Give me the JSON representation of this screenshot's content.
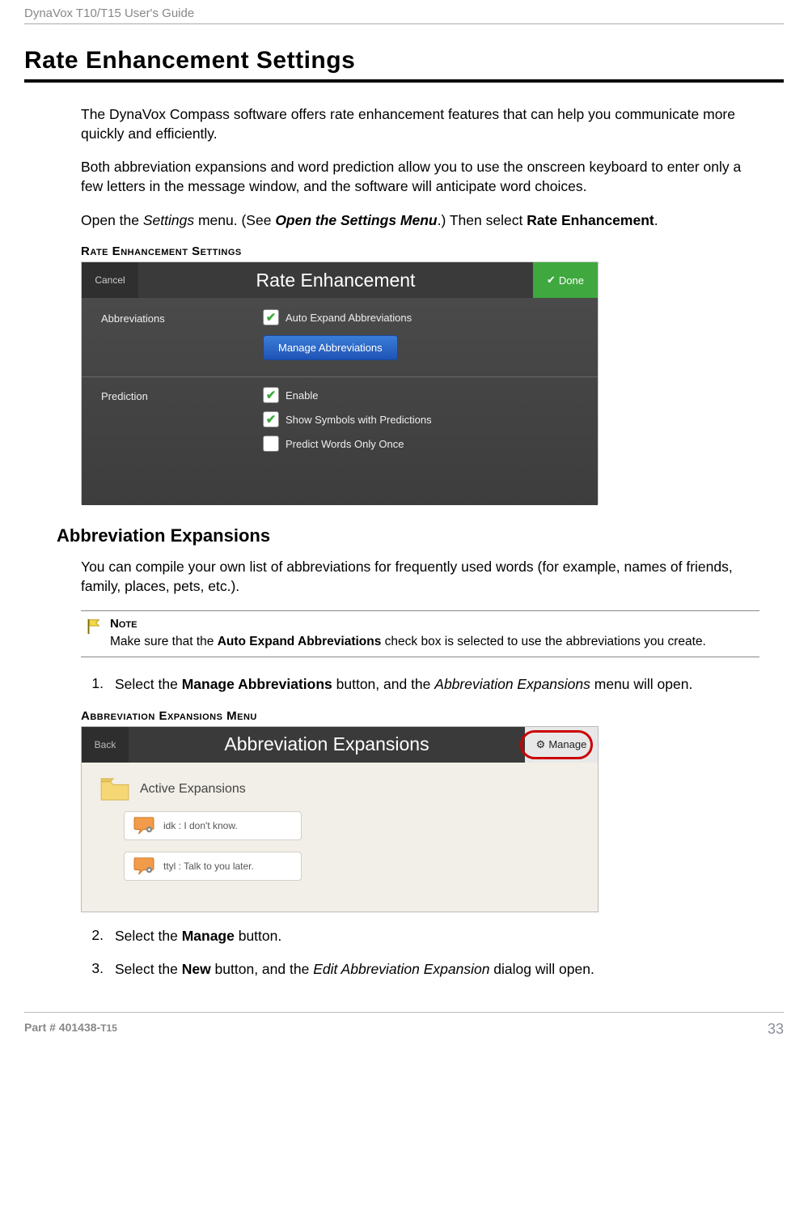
{
  "header": {
    "guide_title": "DynaVox T10/T15 User's Guide"
  },
  "title": "Rate Enhancement Settings",
  "para1": "The DynaVox Compass software offers rate enhancement features that can help you communicate more quickly and efficiently.",
  "para2": "Both abbreviation expansions and word prediction allow you to use the onscreen keyboard to enter only a few letters in the message window, and the software will anticipate word choices.",
  "para3_a": "Open the ",
  "para3_b": "Settings",
  "para3_c": " menu. (See ",
  "para3_d": "Open the Settings Menu",
  "para3_e": ".) Then select ",
  "para3_f": "Rate Enhancement",
  "para3_g": ".",
  "caption1": "Rate Enhancement Settings",
  "shot1": {
    "cancel": "Cancel",
    "title": "Rate Enhancement",
    "done": "Done",
    "abbrev_label": "Abbreviations",
    "auto_expand": "Auto Expand Abbreviations",
    "manage_btn": "Manage Abbreviations",
    "pred_label": "Prediction",
    "enable": "Enable",
    "show_sym": "Show Symbols with Predictions",
    "predict_once": "Predict Words Only Once"
  },
  "h2": "Abbreviation Expansions",
  "para4": "You can compile your own list of abbreviations for frequently used words (for example, names of friends, family, places, pets, etc.).",
  "note": {
    "label": "Note",
    "text_a": "Make sure that the ",
    "text_b": "Auto Expand Abbreviations",
    "text_c": " check box is selected to use the abbreviations you create."
  },
  "step1_a": "Select the ",
  "step1_b": "Manage Abbreviations",
  "step1_c": " button, and the ",
  "step1_d": "Abbreviation Expansions",
  "step1_e": " menu will open.",
  "caption2": "Abbreviation Expansions Menu",
  "shot2": {
    "back": "Back",
    "title": "Abbreviation Expansions",
    "manage": "Manage",
    "section": "Active Expansions",
    "item1": "idk : I don't know.",
    "item2": "ttyl : Talk to you later."
  },
  "step2_a": "Select the ",
  "step2_b": "Manage",
  "step2_c": " button.",
  "step3_a": "Select the ",
  "step3_b": "New",
  "step3_c": " button, and the ",
  "step3_d": "Edit Abbreviation Expansion",
  "step3_e": " dialog will open.",
  "footer": {
    "part_a": "Part # 401438-",
    "part_b": "T15",
    "page": "33"
  }
}
